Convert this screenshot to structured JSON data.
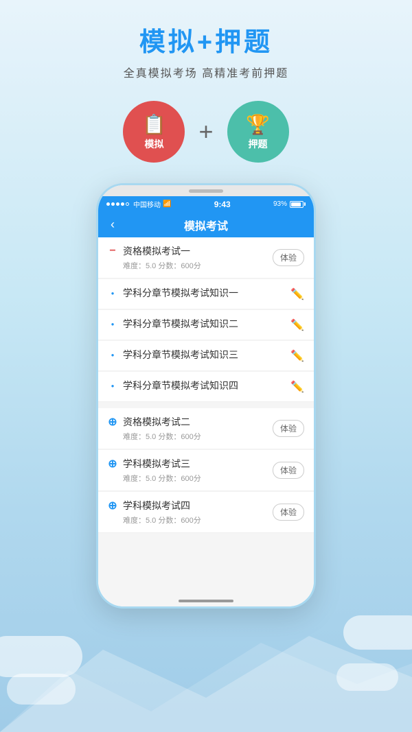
{
  "page": {
    "background_gradient_start": "#e8f4fb",
    "background_gradient_end": "#a0cce8"
  },
  "header": {
    "main_title": "模拟+押题",
    "sub_title": "全真模拟考场 高精准考前押题",
    "icon_left_label": "模拟",
    "icon_right_label": "押题",
    "plus_sign": "+"
  },
  "phone": {
    "status_bar": {
      "carrier": "中国移动",
      "wifi": "WiFi",
      "time": "9:43",
      "battery": "93%"
    },
    "app_header": {
      "back_icon": "‹",
      "title": "模拟考试"
    },
    "list_items": [
      {
        "id": 1,
        "dot_type": "minus",
        "title": "资格模拟考试一",
        "subtitle": "难度：5.0   分数：600分",
        "action": "体验",
        "action_type": "button",
        "edit_active": false
      },
      {
        "id": 2,
        "dot_type": "bullet",
        "title": "学科分章节模拟考试知识一",
        "subtitle": "",
        "action": "edit",
        "action_type": "icon",
        "edit_active": true
      },
      {
        "id": 3,
        "dot_type": "bullet",
        "title": "学科分章节模拟考试知识二",
        "subtitle": "",
        "action": "edit",
        "action_type": "icon",
        "edit_active": false
      },
      {
        "id": 4,
        "dot_type": "bullet",
        "title": "学科分章节模拟考试知识三",
        "subtitle": "",
        "action": "edit",
        "action_type": "icon",
        "edit_active": true
      },
      {
        "id": 5,
        "dot_type": "bullet",
        "title": "学科分章节模拟考试知识四",
        "subtitle": "",
        "action": "edit",
        "action_type": "icon",
        "edit_active": true
      },
      {
        "id": 6,
        "dot_type": "plus_blue",
        "title": "资格模拟考试二",
        "subtitle": "难度：5.0   分数：600分",
        "action": "体验",
        "action_type": "button",
        "edit_active": false
      },
      {
        "id": 7,
        "dot_type": "plus_blue",
        "title": "学科模拟考试三",
        "subtitle": "难度：5.0   分数：600分",
        "action": "体验",
        "action_type": "button",
        "edit_active": false
      },
      {
        "id": 8,
        "dot_type": "plus_blue",
        "title": "学科模拟考试四",
        "subtitle": "难度：5.0   分数：600分",
        "action": "体验",
        "action_type": "button",
        "edit_active": false
      }
    ]
  }
}
